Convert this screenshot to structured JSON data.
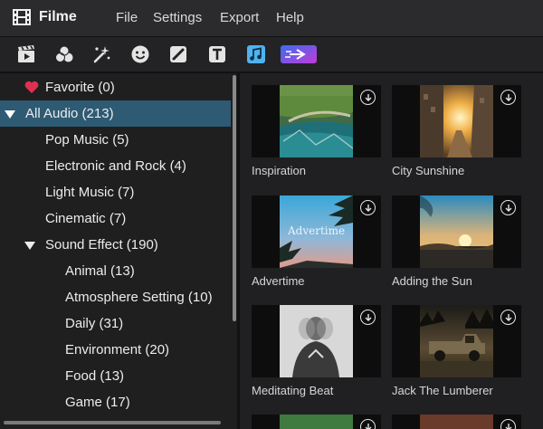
{
  "app": {
    "name": "Filme"
  },
  "menu": {
    "items": [
      "File",
      "Settings",
      "Export",
      "Help"
    ]
  },
  "toolbar": {
    "buttons": [
      {
        "icon": "clapperboard-icon"
      },
      {
        "icon": "effects-circles-icon"
      },
      {
        "icon": "sparkle-transition-icon"
      },
      {
        "icon": "face-sticker-icon"
      },
      {
        "icon": "slash-filter-icon"
      },
      {
        "icon": "text-icon"
      },
      {
        "icon": "music-note-icon",
        "active": true
      },
      {
        "icon": "special-effects-badge-icon"
      }
    ]
  },
  "tree": {
    "items": [
      {
        "label": "Favorite (0)",
        "level": 0,
        "icon": "heart-icon"
      },
      {
        "label": "All Audio (213)",
        "level": 0,
        "expanded": true,
        "selected": true
      },
      {
        "label": "Pop Music (5)",
        "level": 1
      },
      {
        "label": "Electronic and Rock (4)",
        "level": 1
      },
      {
        "label": "Light Music (7)",
        "level": 1
      },
      {
        "label": "Cinematic (7)",
        "level": 1
      },
      {
        "label": "Sound Effect (190)",
        "level": 1,
        "expanded": true
      },
      {
        "label": "Animal (13)",
        "level": 2
      },
      {
        "label": "Atmosphere Setting (10)",
        "level": 2
      },
      {
        "label": "Daily (31)",
        "level": 2
      },
      {
        "label": "Environment (20)",
        "level": 2
      },
      {
        "label": "Food (13)",
        "level": 2
      },
      {
        "label": "Game (17)",
        "level": 2
      }
    ]
  },
  "cards": [
    {
      "title": "Inspiration"
    },
    {
      "title": "City Sunshine"
    },
    {
      "title": "Advertime",
      "thumb_text": "Advertime"
    },
    {
      "title": "Adding the Sun"
    },
    {
      "title": "Meditating Beat"
    },
    {
      "title": "Jack The Lumberer"
    }
  ],
  "colors": {
    "selection": "#2e5a73",
    "heart": "#e0304e",
    "music_icon": "#4fb3f0"
  }
}
